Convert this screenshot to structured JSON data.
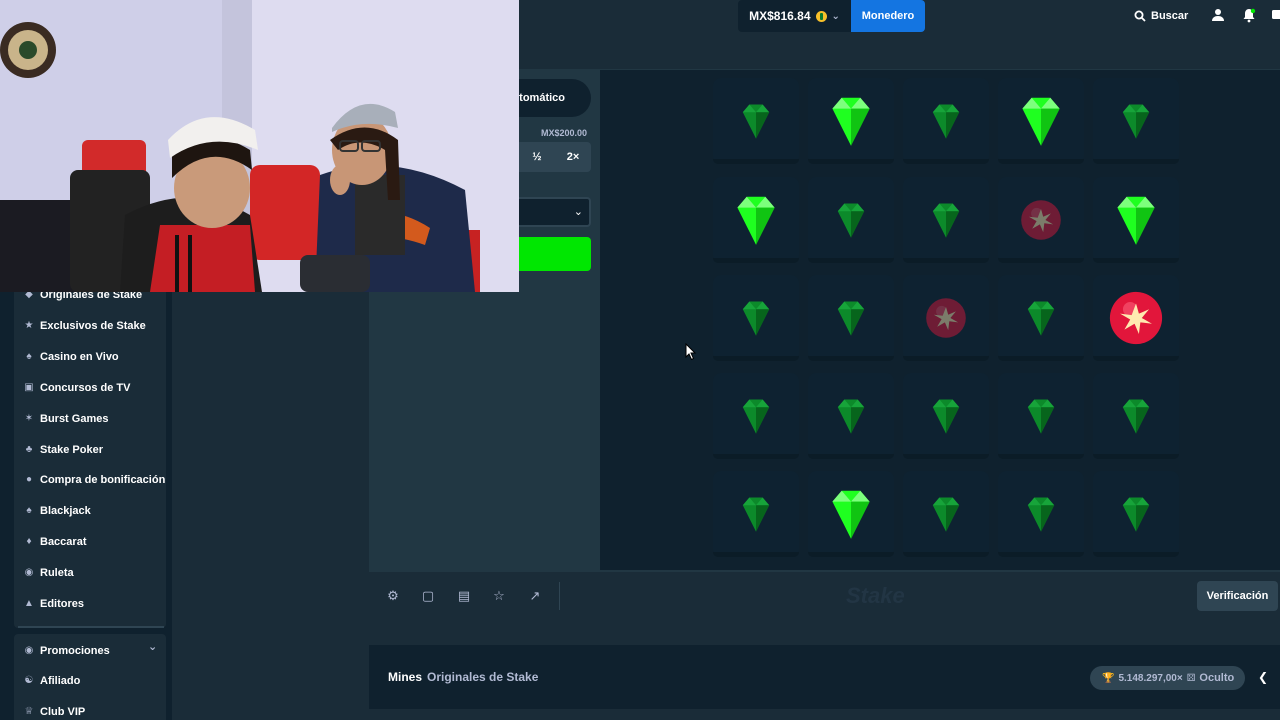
{
  "header": {
    "balance": "MX$816.84",
    "wallet_label": "Monedero",
    "search_label": "Buscar"
  },
  "controls": {
    "mode_label": "utomático",
    "amount": "MX$200.00",
    "half_label": "½",
    "double_label": "2×"
  },
  "sidebar": {
    "items": [
      {
        "label": "Originales de Stake",
        "icon": "originals-icon"
      },
      {
        "label": "Exclusivos de Stake",
        "icon": "exclusive-icon"
      },
      {
        "label": "Casino en Vivo",
        "icon": "live-casino-icon"
      },
      {
        "label": "Concursos de TV",
        "icon": "tv-icon"
      },
      {
        "label": "Burst Games",
        "icon": "burst-icon"
      },
      {
        "label": "Stake Poker",
        "icon": "poker-icon"
      },
      {
        "label": "Compra de bonificación",
        "icon": "bonus-buy-icon"
      },
      {
        "label": "Blackjack",
        "icon": "blackjack-icon"
      },
      {
        "label": "Baccarat",
        "icon": "baccarat-icon"
      },
      {
        "label": "Ruleta",
        "icon": "roulette-icon"
      },
      {
        "label": "Editores",
        "icon": "editors-icon"
      }
    ],
    "bottom_items": [
      {
        "label": "Promociones",
        "icon": "promotions-icon"
      },
      {
        "label": "Afiliado",
        "icon": "affiliate-icon"
      },
      {
        "label": "Club VIP",
        "icon": "vip-icon"
      }
    ]
  },
  "board": {
    "rows": [
      [
        "gem",
        "gem-revealed",
        "gem",
        "gem-revealed",
        "gem"
      ],
      [
        "gem-revealed",
        "gem",
        "gem",
        "mine",
        "gem-revealed"
      ],
      [
        "gem",
        "gem",
        "mine",
        "gem",
        "mine-revealed"
      ],
      [
        "gem",
        "gem",
        "gem",
        "gem",
        "gem"
      ],
      [
        "gem",
        "gem-revealed",
        "gem",
        "gem",
        "gem"
      ]
    ]
  },
  "footer": {
    "logo": "Stake",
    "verify_label": "Verificación",
    "game_name": "Mines",
    "provider": "Originales de Stake",
    "max_win": "5.148.297,00×",
    "visibility": "Oculto"
  },
  "colors": {
    "accent": "#1475e1",
    "bet": "#00e701",
    "gem_bright": "#1fff20",
    "gem_dim": "#0c8a2a",
    "mine": "#e2163b"
  }
}
